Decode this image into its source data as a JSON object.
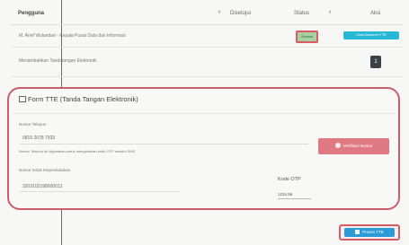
{
  "table": {
    "headers": {
      "pengguna": "Pengguna",
      "disetujui": "Disetujui",
      "status": "Status",
      "aksi": "Aksi"
    },
    "rows": [
      {
        "pengguna": "M. Arief Wulandari - Kepala Pusat Data dan Informasi",
        "status_badge": "Selesai",
        "aksi_label": "Lihat Dokumen TTE"
      },
      {
        "pengguna": "Menambahkan Tandatangan Elektronik",
        "aksi_label": "1"
      }
    ]
  },
  "form": {
    "title": "Form TTE (Tanda Tangan Elektronik)",
    "nomor_telepon_label": "Nomor Telepon",
    "nomor_telepon_value": "0815 2078 7933",
    "info_text": "Nomor Telepon ini digunakan untuk mengirimkan kode OTP melalui SMS",
    "verify_button": "Verifikasi Nomor",
    "nik_label": "Nomor Induk Kependudukan",
    "nik_value": "3203102198000012",
    "otp_label": "Kode OTP",
    "otp_value": "1234 56"
  },
  "proses_button": "Proses TTE",
  "colors": {
    "highlight": "#c95f6b",
    "primary": "#2d9ad8",
    "info": "#29b7d6",
    "success": "#a8d0a2",
    "danger": "#e07a82"
  }
}
